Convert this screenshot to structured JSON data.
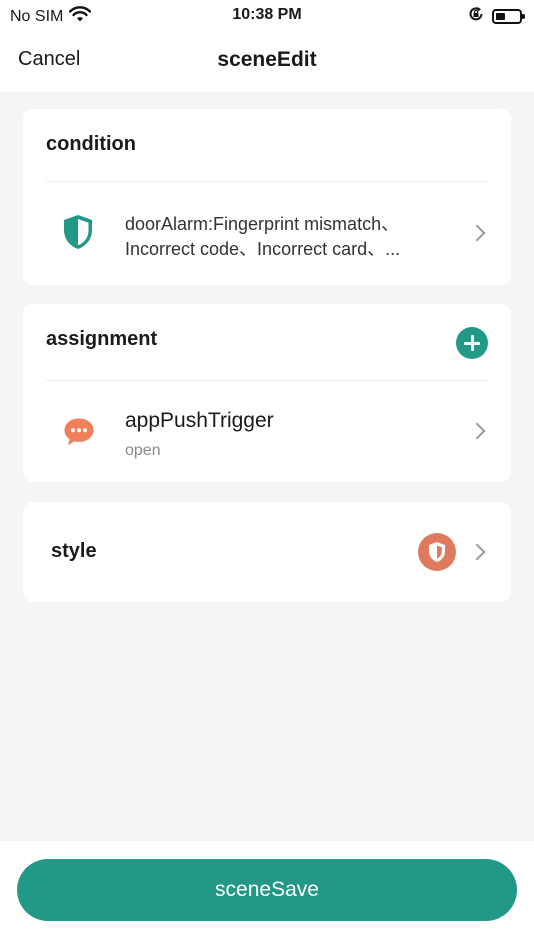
{
  "status_bar": {
    "carrier": "No SIM",
    "time": "10:38 PM",
    "icons": [
      "wifi-icon",
      "orientation-lock-icon",
      "battery-icon"
    ]
  },
  "nav": {
    "cancel_label": "Cancel",
    "title": "sceneEdit"
  },
  "condition": {
    "header": "condition",
    "icon": "shield-icon",
    "line1": "doorAlarm:Fingerprint mismatch、",
    "line2": "Incorrect code、Incorrect card、..."
  },
  "assignment": {
    "header": "assignment",
    "add_icon": "plus-icon",
    "item": {
      "icon": "chat-bubble-icon",
      "name": "appPushTrigger",
      "status": "open"
    }
  },
  "style": {
    "label": "style",
    "icon": "shield-icon"
  },
  "footer": {
    "save_label": "sceneSave"
  },
  "colors": {
    "accent": "#229987",
    "chat_icon": "#f07f5c",
    "style_badge": "#e07a5f",
    "background": "#f5f5f5"
  }
}
